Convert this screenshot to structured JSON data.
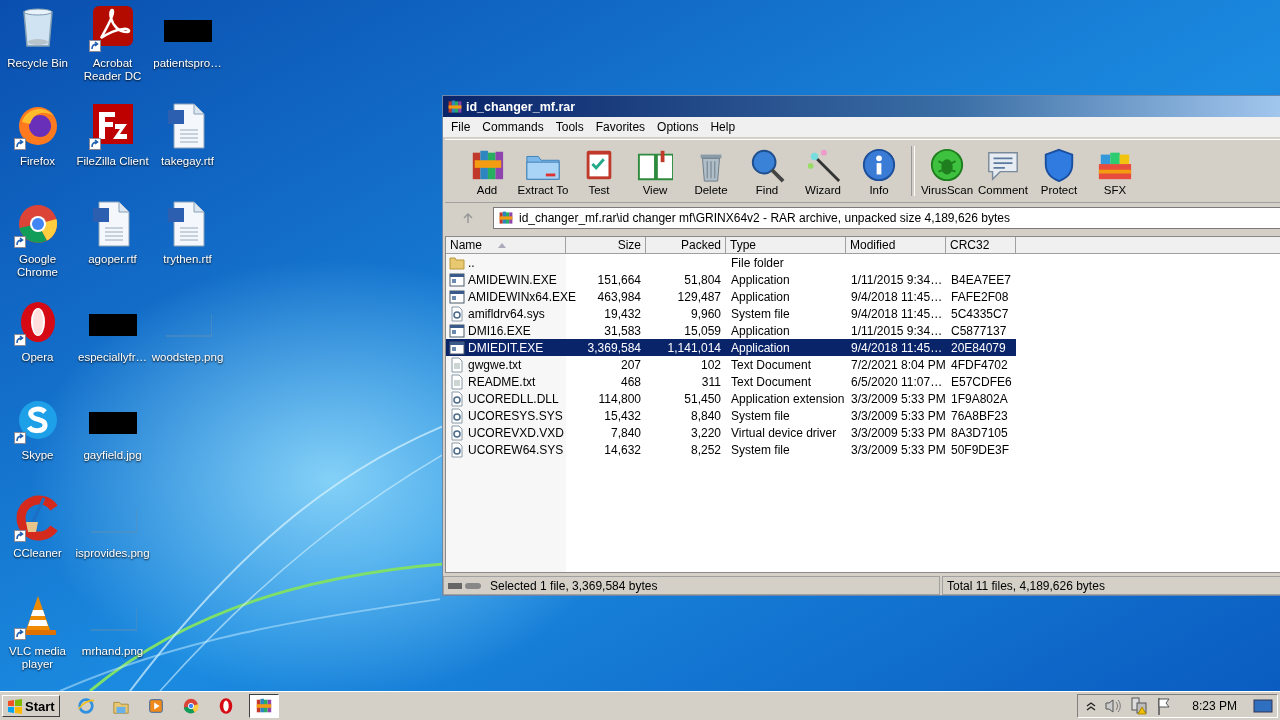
{
  "desktop_icons": [
    {
      "label": "Recycle Bin",
      "kind": "recycle",
      "shortcut": false
    },
    {
      "label": "Firefox",
      "kind": "firefox",
      "shortcut": true
    },
    {
      "label": "Google Chrome",
      "kind": "chrome",
      "shortcut": true
    },
    {
      "label": "Opera",
      "kind": "opera",
      "shortcut": true
    },
    {
      "label": "Skype",
      "kind": "skype",
      "shortcut": true
    },
    {
      "label": "CCleaner",
      "kind": "ccleaner",
      "shortcut": true
    },
    {
      "label": "VLC media player",
      "kind": "vlc",
      "shortcut": true
    },
    {
      "label": "Acrobat Reader DC",
      "kind": "acrobat",
      "shortcut": true
    },
    {
      "label": "FileZilla Client",
      "kind": "filezilla",
      "shortcut": true
    },
    {
      "label": "agoper.rtf",
      "kind": "word",
      "shortcut": false
    },
    {
      "label": "especiallyfr…",
      "kind": "dark-thumb",
      "shortcut": false
    },
    {
      "label": "gayfield.jpg",
      "kind": "dark-thumb",
      "shortcut": false
    },
    {
      "label": "isprovides.png",
      "kind": "blank-thumb",
      "shortcut": false
    },
    {
      "label": "mrhand.png",
      "kind": "blank-thumb",
      "shortcut": false
    },
    {
      "label": "patientspro…",
      "kind": "dark-thumb",
      "shortcut": false
    },
    {
      "label": "takegay.rtf",
      "kind": "word",
      "shortcut": false
    },
    {
      "label": "trythen.rtf",
      "kind": "word",
      "shortcut": false
    },
    {
      "label": "woodstep.png",
      "kind": "blank-thumb",
      "shortcut": false
    }
  ],
  "window": {
    "title": "id_changer_mf.rar",
    "menu": [
      "File",
      "Commands",
      "Tools",
      "Favorites",
      "Options",
      "Help"
    ],
    "toolbar_groups": [
      [
        {
          "label": "Add",
          "kind": "add"
        },
        {
          "label": "Extract To",
          "kind": "extract"
        },
        {
          "label": "Test",
          "kind": "test"
        },
        {
          "label": "View",
          "kind": "view"
        },
        {
          "label": "Delete",
          "kind": "delete"
        },
        {
          "label": "Find",
          "kind": "find"
        },
        {
          "label": "Wizard",
          "kind": "wizard"
        },
        {
          "label": "Info",
          "kind": "info"
        }
      ],
      [
        {
          "label": "VirusScan",
          "kind": "virus"
        },
        {
          "label": "Comment",
          "kind": "comment"
        },
        {
          "label": "Protect",
          "kind": "protect"
        },
        {
          "label": "SFX",
          "kind": "sfx"
        }
      ]
    ],
    "address": "id_changer_mf.rar\\id changer mf\\GRINX64v2 - RAR archive, unpacked size 4,189,626 bytes",
    "columns": [
      {
        "label": "Name",
        "sorted": true
      },
      {
        "label": "Size",
        "sorted": false
      },
      {
        "label": "Packed",
        "sorted": false
      },
      {
        "label": "Type",
        "sorted": false
      },
      {
        "label": "Modified",
        "sorted": false
      },
      {
        "label": "CRC32",
        "sorted": false
      }
    ],
    "rows": [
      {
        "kind": "folder",
        "name": "..",
        "type": "File folder",
        "selected": false
      },
      {
        "kind": "exe",
        "name": "AMIDEWIN.EXE",
        "size": "151,664",
        "packed": "51,804",
        "type": "Application",
        "modified": "1/11/2015 9:34…",
        "crc32": "B4EA7EE7",
        "selected": false
      },
      {
        "kind": "exe",
        "name": "AMIDEWINx64.EXE",
        "size": "463,984",
        "packed": "129,487",
        "type": "Application",
        "modified": "9/4/2018 11:45…",
        "crc32": "FAFE2F08",
        "selected": false
      },
      {
        "kind": "sys",
        "name": "amifldrv64.sys",
        "size": "19,432",
        "packed": "9,960",
        "type": "System file",
        "modified": "9/4/2018 11:45…",
        "crc32": "5C4335C7",
        "selected": false
      },
      {
        "kind": "exe",
        "name": "DMI16.EXE",
        "size": "31,583",
        "packed": "15,059",
        "type": "Application",
        "modified": "1/11/2015 9:34…",
        "crc32": "C5877137",
        "selected": false
      },
      {
        "kind": "exe",
        "name": "DMIEDIT.EXE",
        "size": "3,369,584",
        "packed": "1,141,014",
        "type": "Application",
        "modified": "9/4/2018 11:45…",
        "crc32": "20E84079",
        "selected": true
      },
      {
        "kind": "txt",
        "name": "gwgwe.txt",
        "size": "207",
        "packed": "102",
        "type": "Text Document",
        "modified": "7/2/2021 8:04 PM",
        "crc32": "4FDF4702",
        "selected": false
      },
      {
        "kind": "txt",
        "name": "README.txt",
        "size": "468",
        "packed": "311",
        "type": "Text Document",
        "modified": "6/5/2020 11:07…",
        "crc32": "E57CDFE6",
        "selected": false
      },
      {
        "kind": "sys",
        "name": "UCOREDLL.DLL",
        "size": "114,800",
        "packed": "51,450",
        "type": "Application extension",
        "modified": "3/3/2009 5:33 PM",
        "crc32": "1F9A802A",
        "selected": false
      },
      {
        "kind": "sys",
        "name": "UCORESYS.SYS",
        "size": "15,432",
        "packed": "8,840",
        "type": "System file",
        "modified": "3/3/2009 5:33 PM",
        "crc32": "76A8BF23",
        "selected": false
      },
      {
        "kind": "sys",
        "name": "UCOREVXD.VXD",
        "size": "7,840",
        "packed": "3,220",
        "type": "Virtual device driver",
        "modified": "3/3/2009 5:33 PM",
        "crc32": "8A3D7105",
        "selected": false
      },
      {
        "kind": "sys",
        "name": "UCOREW64.SYS",
        "size": "14,632",
        "packed": "8,252",
        "type": "System file",
        "modified": "3/3/2009 5:33 PM",
        "crc32": "50F9DE3F",
        "selected": false
      }
    ],
    "status_left": "Selected 1 file, 3,369,584 bytes",
    "status_right": "Total 11 files, 4,189,626 bytes"
  },
  "taskbar": {
    "start": "Start",
    "apps": [
      {
        "kind": "ie",
        "selected": false
      },
      {
        "kind": "explorer",
        "selected": false
      },
      {
        "kind": "media",
        "selected": false
      },
      {
        "kind": "chrome",
        "selected": false
      },
      {
        "kind": "opera",
        "selected": false
      },
      {
        "kind": "winrar",
        "selected": true
      }
    ],
    "clock": "8:23 PM"
  }
}
